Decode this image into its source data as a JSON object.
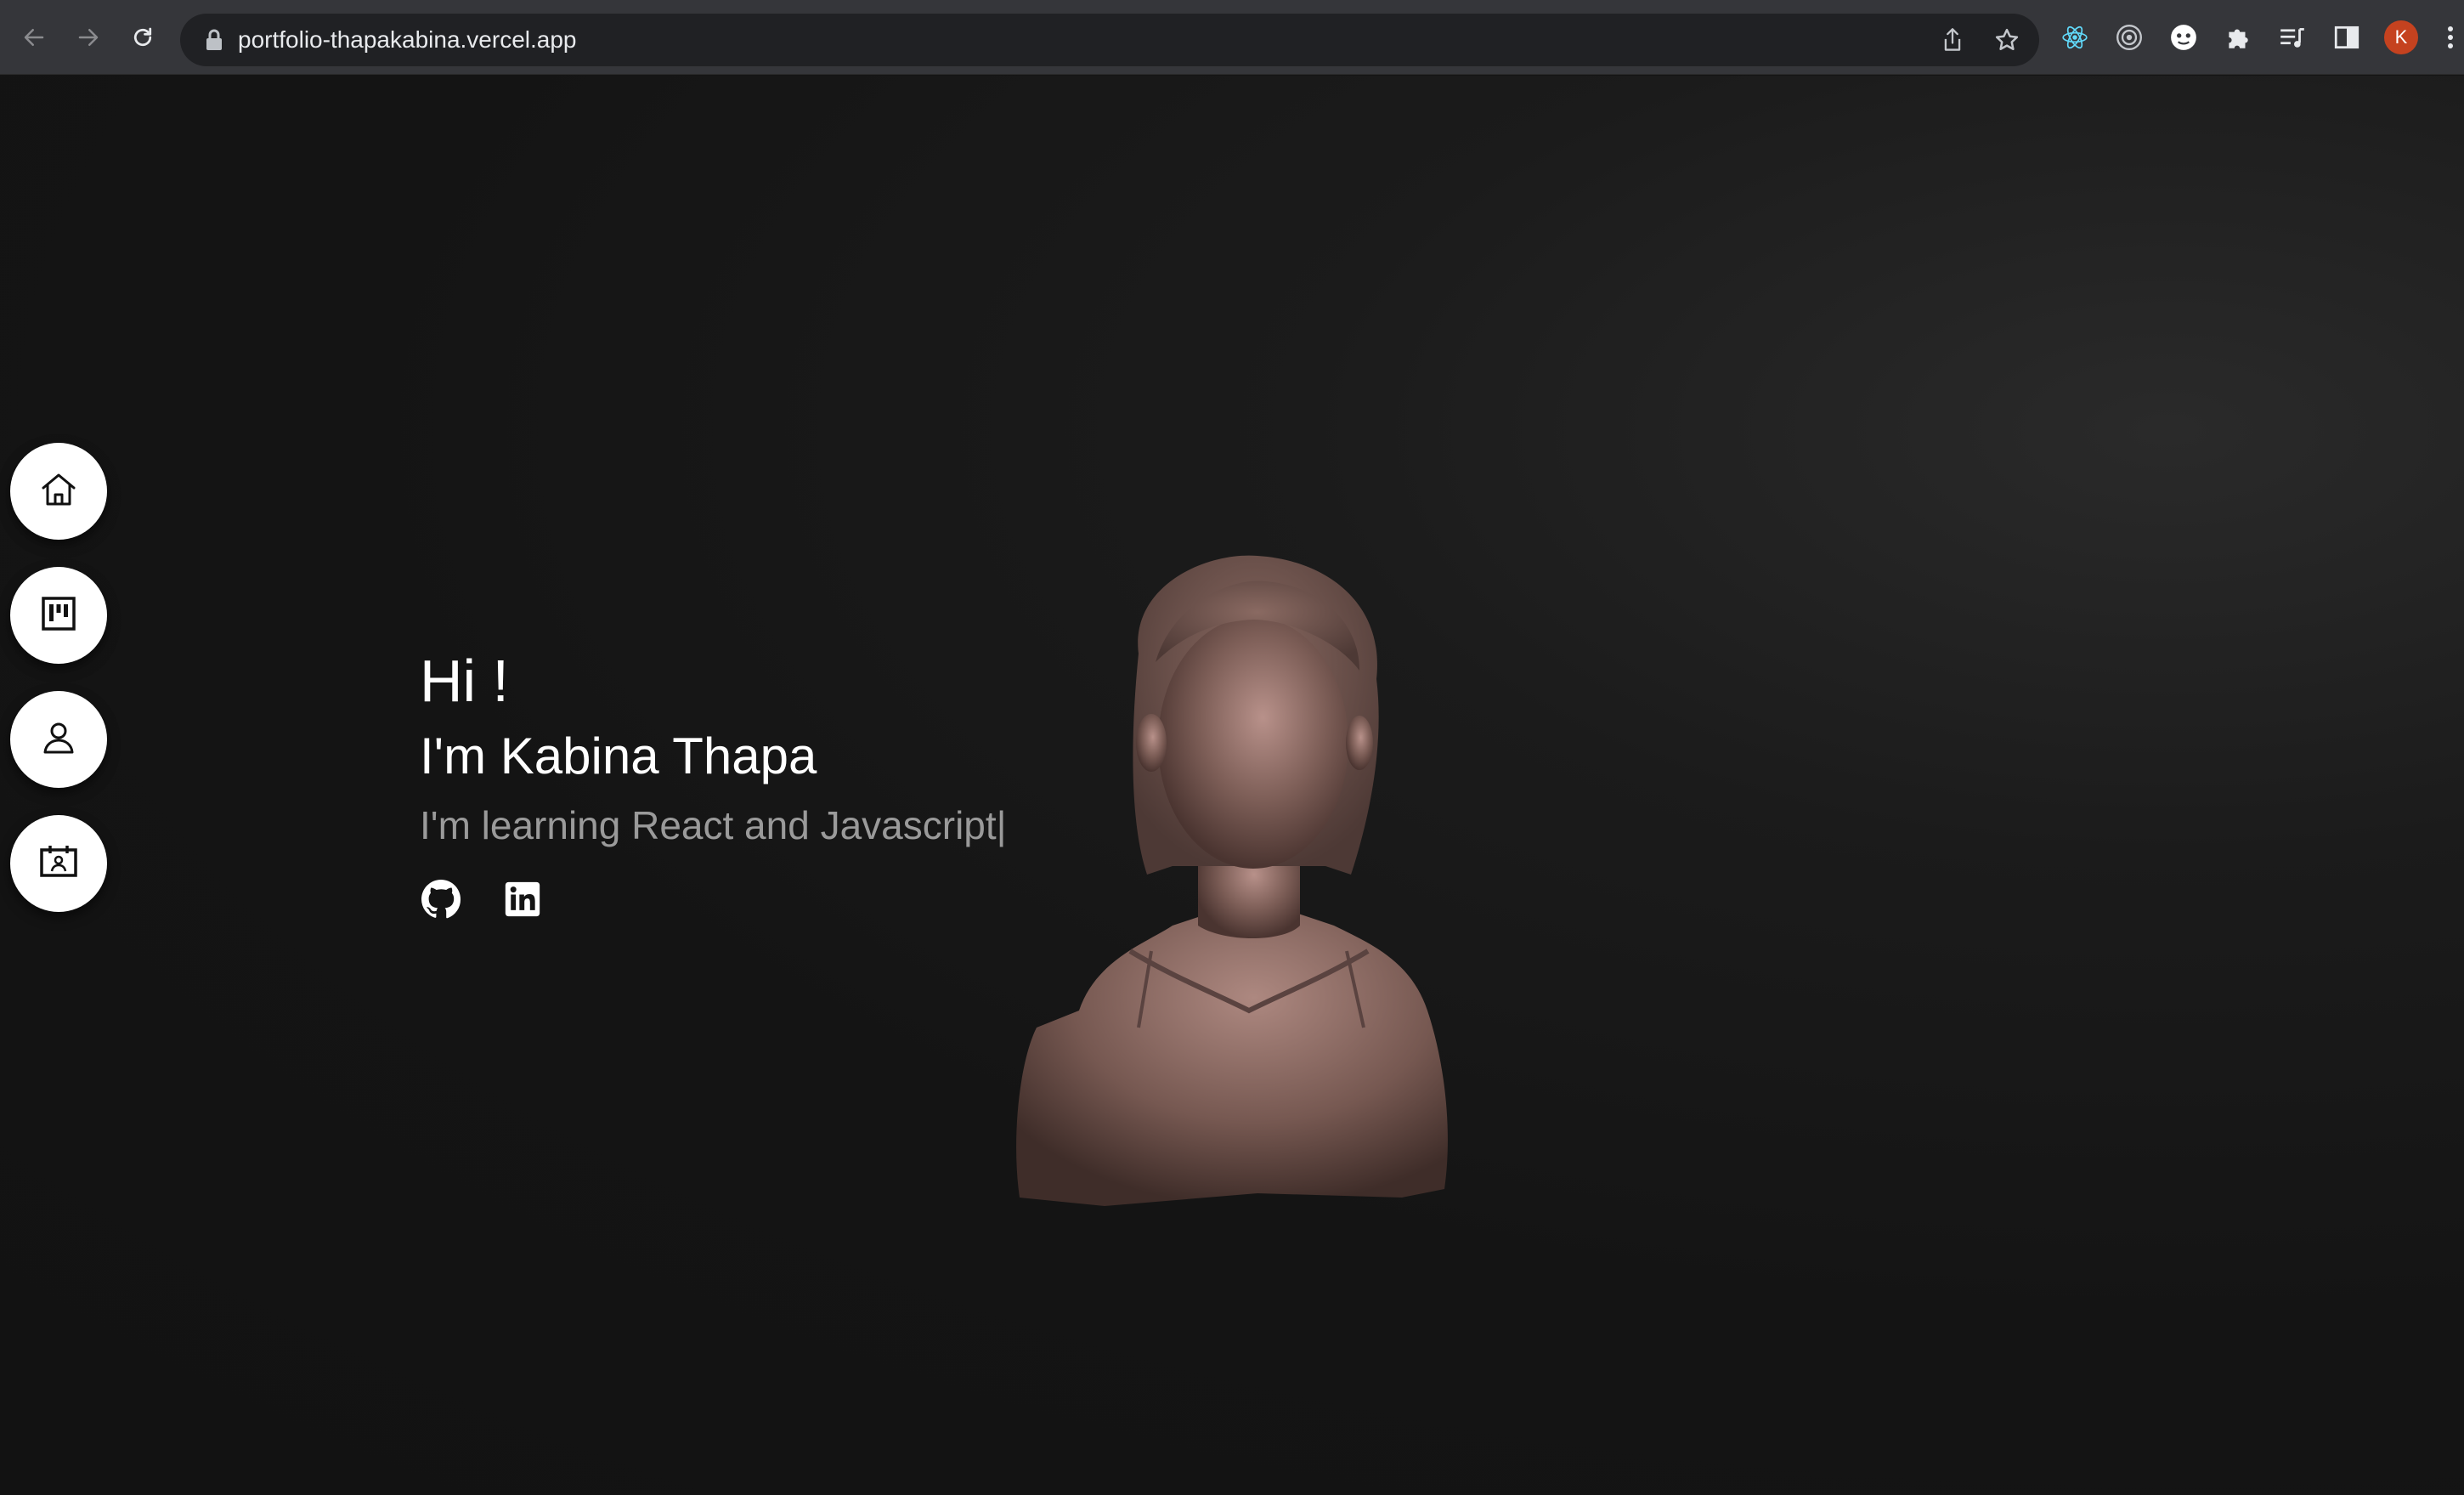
{
  "browser": {
    "url": "portfolio-thapakabina.vercel.app",
    "profile_initial": "K",
    "nav_icons": [
      "back-arrow-icon",
      "forward-arrow-icon",
      "reload-icon"
    ],
    "omnibox_icons": [
      "lock-icon",
      "share-icon",
      "star-bookmark-icon"
    ],
    "extension_icons": [
      "react-devtools-icon",
      "target-extension-icon",
      "ghost-extension-icon",
      "puzzle-extensions-icon",
      "reading-list-icon",
      "side-panel-icon",
      "kebab-menu-icon"
    ],
    "accent_colors": {
      "react": "#61dafb",
      "avatar": "#c5421f"
    }
  },
  "sidebar": {
    "items": [
      {
        "name": "home",
        "icon": "home-icon"
      },
      {
        "name": "projects",
        "icon": "kanban-board-icon"
      },
      {
        "name": "about",
        "icon": "person-icon"
      },
      {
        "name": "contact",
        "icon": "contact-card-icon"
      }
    ]
  },
  "hero": {
    "greeting": "Hi !",
    "name": "I'm Kabina Thapa",
    "tagline": "I'm learning React and Javascript|",
    "social": [
      "github-icon",
      "linkedin-icon"
    ]
  },
  "avatar_model": {
    "icon": "3d-bust-figure",
    "color": "#8a6a62"
  }
}
